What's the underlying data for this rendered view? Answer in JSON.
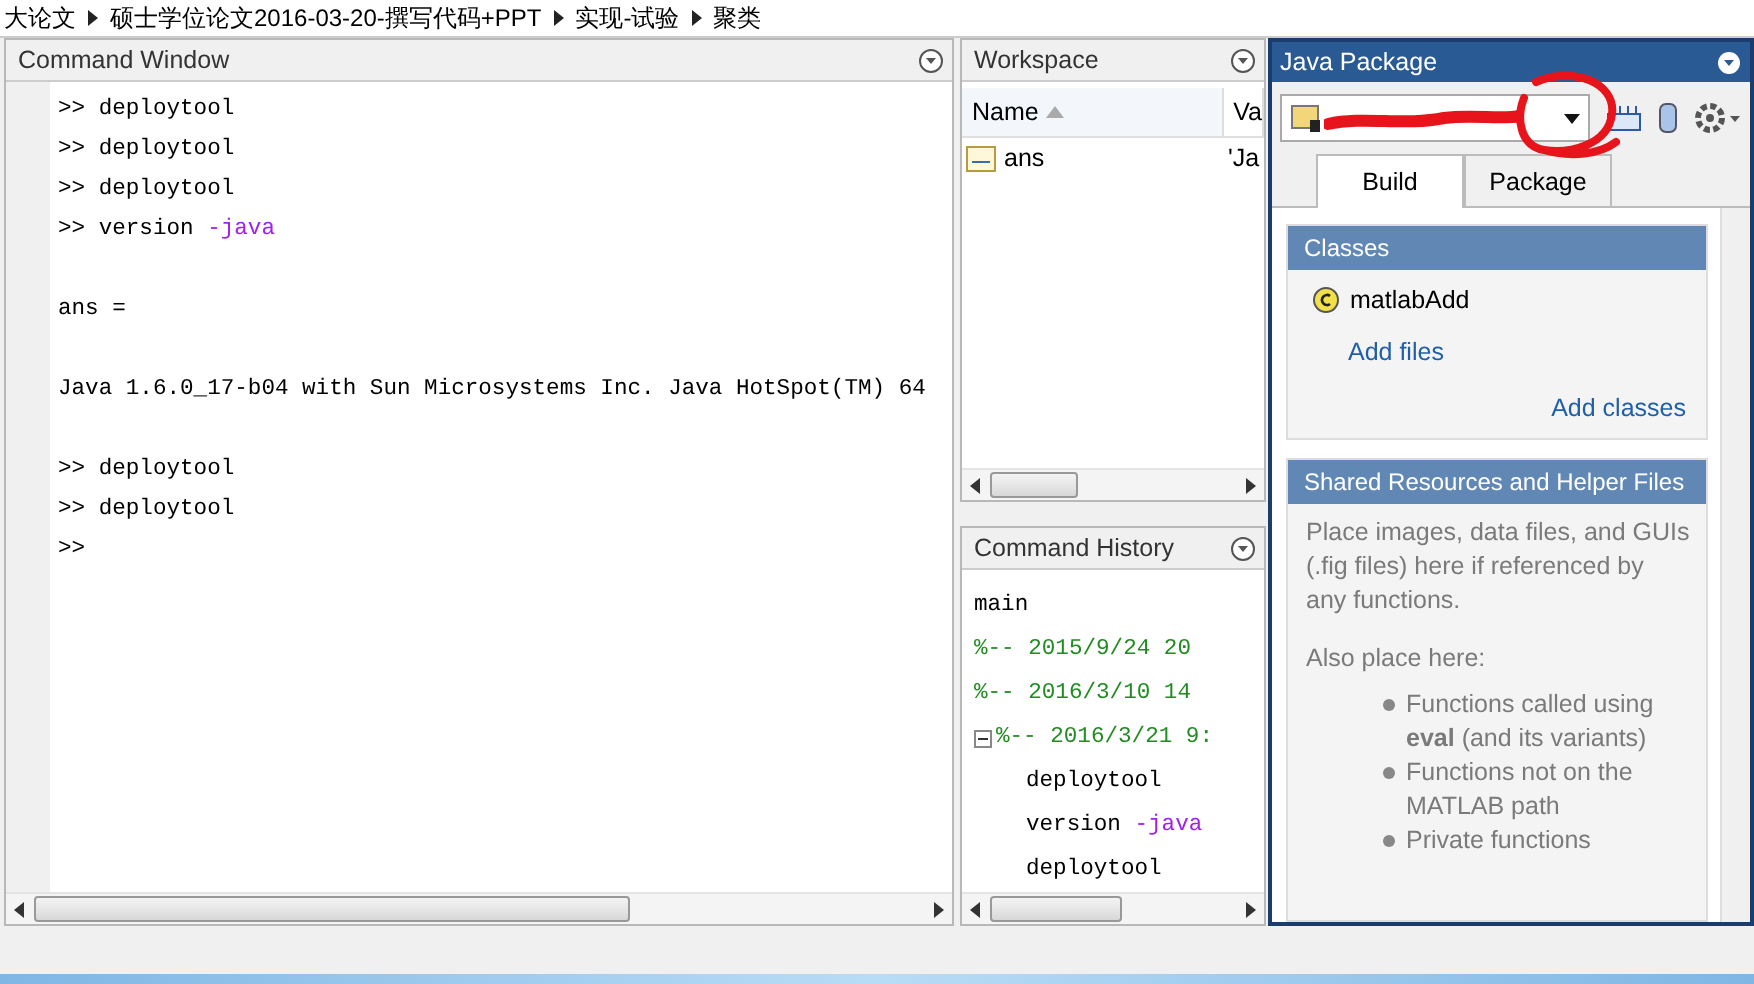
{
  "breadcrumb": [
    "大论文",
    "硕士学位论文2016-03-20-撰写代码+PPT",
    "实现-试验",
    "聚类"
  ],
  "command_window": {
    "title": "Command Window",
    "lines": [
      {
        "kind": "command",
        "prompt": ">>",
        "text": "deploytool"
      },
      {
        "kind": "command",
        "prompt": ">>",
        "text": "deploytool"
      },
      {
        "kind": "command",
        "prompt": ">>",
        "text": "deploytool"
      },
      {
        "kind": "command",
        "prompt": ">>",
        "text": "version",
        "arg": "-java"
      },
      {
        "kind": "blank"
      },
      {
        "kind": "output",
        "text": "ans ="
      },
      {
        "kind": "blank"
      },
      {
        "kind": "output",
        "text": "Java 1.6.0_17-b04 with Sun Microsystems Inc. Java HotSpot(TM) 64"
      },
      {
        "kind": "blank"
      },
      {
        "kind": "command",
        "prompt": ">>",
        "text": "deploytool"
      },
      {
        "kind": "command",
        "prompt": ">>",
        "text": "deploytool"
      },
      {
        "kind": "prompt",
        "prompt": ">>"
      }
    ]
  },
  "workspace": {
    "title": "Workspace",
    "columns": [
      {
        "label": "Name",
        "sorted": true
      },
      {
        "label": "Va"
      }
    ],
    "rows": [
      {
        "name": "ans",
        "value": "'Ja"
      }
    ]
  },
  "command_history": {
    "title": "Command History",
    "items": [
      {
        "kind": "command",
        "text": "main"
      },
      {
        "kind": "session",
        "text": "%-- 2015/9/24 20"
      },
      {
        "kind": "session",
        "text": "%-- 2016/3/10 14"
      },
      {
        "kind": "session",
        "text": "%-- 2016/3/21 9:",
        "expanded": true,
        "children": [
          {
            "kind": "command",
            "text": "deploytool"
          },
          {
            "kind": "command",
            "text": "version",
            "arg": "-java"
          },
          {
            "kind": "command",
            "text": "deploytool"
          }
        ]
      }
    ]
  },
  "java_package": {
    "title": "Java Package",
    "tabs": [
      {
        "label": "Build",
        "selected": true
      },
      {
        "label": "Package",
        "selected": false
      }
    ],
    "classes": {
      "title": "Classes",
      "items": [
        "matlabAdd"
      ],
      "add_files": "Add files",
      "add_classes": "Add classes"
    },
    "shared": {
      "title": "Shared Resources and Helper Files",
      "description": "Place images, data files, and GUIs (.fig files) here if referenced by any functions.",
      "also": "Also place here:",
      "bullets": [
        "Functions called using **eval** (and its variants)",
        "Functions not on the MATLAB path",
        "Private functions"
      ]
    }
  }
}
